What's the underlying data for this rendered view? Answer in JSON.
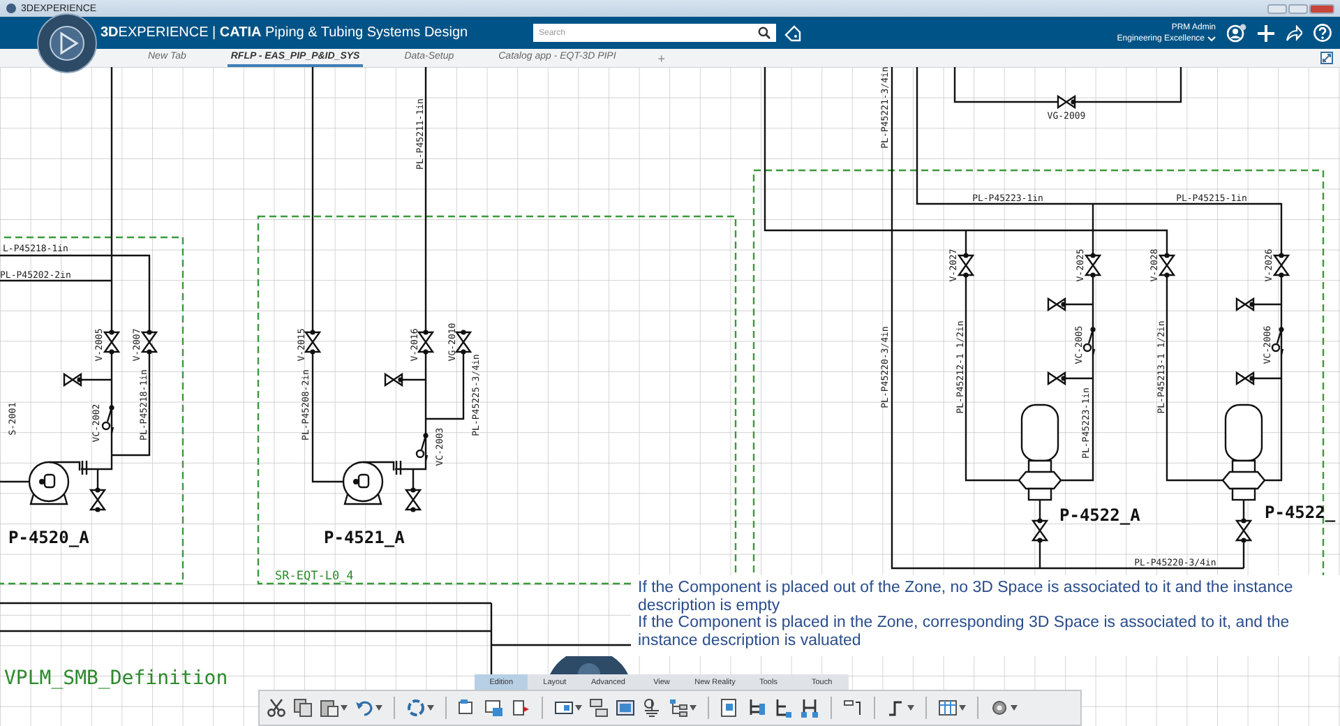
{
  "window": {
    "title": "3DEXPERIENCE"
  },
  "header": {
    "app_title": "**3D**EXPERIENCE | **CATIA** Piping & Tubing Systems Design",
    "search": {
      "placeholder": "Search"
    },
    "user": "PRM Admin",
    "space": "Engineering Excellence"
  },
  "tabs": [
    {
      "label": "New Tab",
      "selected": false
    },
    {
      "label": "RFLP - EAS_PIP_P&ID_SYS",
      "selected": true
    },
    {
      "label": "Data-Setup",
      "selected": false
    },
    {
      "label": "Catalog app - EQT-3D PIPI",
      "selected": false
    }
  ],
  "new_tab": "+",
  "diagram": {
    "labels": [
      {
        "text": "PL-P45211-1in",
        "kind": "line"
      },
      {
        "text": "L-P45218-1in",
        "kind": "line"
      },
      {
        "text": "PL-P45202-2in",
        "kind": "line"
      },
      {
        "text": "V-2005",
        "kind": "tag"
      },
      {
        "text": "V-2007",
        "kind": "tag"
      },
      {
        "text": "PL-P45218-1in",
        "kind": "line"
      },
      {
        "text": "VC-2002",
        "kind": "tag"
      },
      {
        "text": "S-2001",
        "kind": "tag"
      },
      {
        "text": "P-4520_A",
        "kind": "equipment"
      },
      {
        "text": "V-2015",
        "kind": "tag"
      },
      {
        "text": "PL-P45208-2in",
        "kind": "line"
      },
      {
        "text": "V-2016",
        "kind": "tag"
      },
      {
        "text": "VG-2010",
        "kind": "tag"
      },
      {
        "text": "PL-P45225-3/4in",
        "kind": "line"
      },
      {
        "text": "VC-2003",
        "kind": "tag"
      },
      {
        "text": "P-4521_A",
        "kind": "equipment"
      },
      {
        "text": "SR-EQT-L0_4",
        "kind": "zone"
      },
      {
        "text": "PL-P45221-3/4in",
        "kind": "line"
      },
      {
        "text": "VG-2009",
        "kind": "tag"
      },
      {
        "text": "PL-P45223-1in",
        "kind": "line"
      },
      {
        "text": "PL-P45215-1in",
        "kind": "line"
      },
      {
        "text": "V-2027",
        "kind": "tag"
      },
      {
        "text": "V-2025",
        "kind": "tag"
      },
      {
        "text": "V-2028",
        "kind": "tag"
      },
      {
        "text": "V-2026",
        "kind": "tag"
      },
      {
        "text": "VC-2005",
        "kind": "tag"
      },
      {
        "text": "VC-2006",
        "kind": "tag"
      },
      {
        "text": "PL-P45212-1 1/2in",
        "kind": "line"
      },
      {
        "text": "PL-P45223-1in",
        "kind": "line"
      },
      {
        "text": "PL-P45213-1 1/2in",
        "kind": "line"
      },
      {
        "text": "PL-P45220-3/4in",
        "kind": "line"
      },
      {
        "text": "P-4522_A",
        "kind": "equipment"
      },
      {
        "text": "P-4522_",
        "kind": "equipment"
      },
      {
        "text": "PL-P45220-3/4in",
        "kind": "line"
      },
      {
        "text": "VPLM_SMB_Definition",
        "kind": "definition"
      }
    ]
  },
  "caption": [
    "If the Component is placed out of the Zone, no 3D Space is associated to it and the instance description is empty",
    "If the Component is placed in the Zone, corresponding 3D Space is associated to it, and the instance description is valuated"
  ],
  "toolbar": {
    "tabs": [
      {
        "label": "Edition",
        "selected": true
      },
      {
        "label": "Layout",
        "selected": false
      },
      {
        "label": "Advanced",
        "selected": false
      },
      {
        "label": "View",
        "selected": false
      },
      {
        "label": "New Reality",
        "selected": false
      },
      {
        "label": "Tools",
        "selected": false
      },
      {
        "label": "Touch",
        "selected": false
      }
    ]
  }
}
